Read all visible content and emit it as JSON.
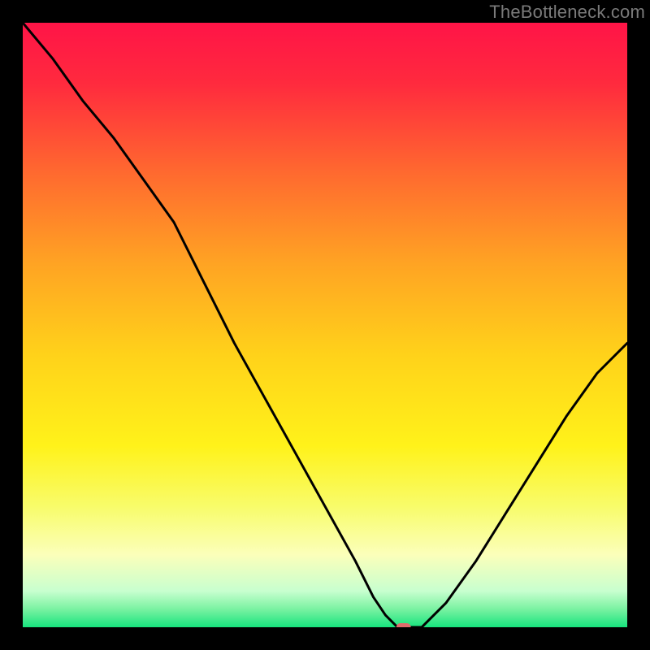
{
  "watermark": "TheBottleneck.com",
  "chart_data": {
    "type": "line",
    "title": "",
    "xlabel": "",
    "ylabel": "",
    "xlim": [
      0,
      100
    ],
    "ylim": [
      0,
      100
    ],
    "x": [
      0,
      5,
      10,
      15,
      20,
      25,
      30,
      35,
      40,
      45,
      50,
      55,
      58,
      60,
      62,
      64,
      66,
      70,
      75,
      80,
      85,
      90,
      95,
      100
    ],
    "values": [
      100,
      94,
      87,
      81,
      74,
      67,
      57,
      47,
      38,
      29,
      20,
      11,
      5,
      2,
      0,
      0,
      0,
      4,
      11,
      19,
      27,
      35,
      42,
      47
    ],
    "marker": {
      "x": 63,
      "y": 0
    },
    "gradient_stops": [
      {
        "offset": 0.0,
        "color": "#ff1447"
      },
      {
        "offset": 0.1,
        "color": "#ff2a3e"
      },
      {
        "offset": 0.25,
        "color": "#ff6a2f"
      },
      {
        "offset": 0.4,
        "color": "#ffa423"
      },
      {
        "offset": 0.55,
        "color": "#ffd21a"
      },
      {
        "offset": 0.7,
        "color": "#fff21a"
      },
      {
        "offset": 0.8,
        "color": "#f8fc6a"
      },
      {
        "offset": 0.88,
        "color": "#fbffba"
      },
      {
        "offset": 0.94,
        "color": "#c8ffcf"
      },
      {
        "offset": 0.97,
        "color": "#7af2a2"
      },
      {
        "offset": 1.0,
        "color": "#17e47e"
      }
    ],
    "marker_color": "#e06b6c",
    "curve_color": "#000000"
  }
}
